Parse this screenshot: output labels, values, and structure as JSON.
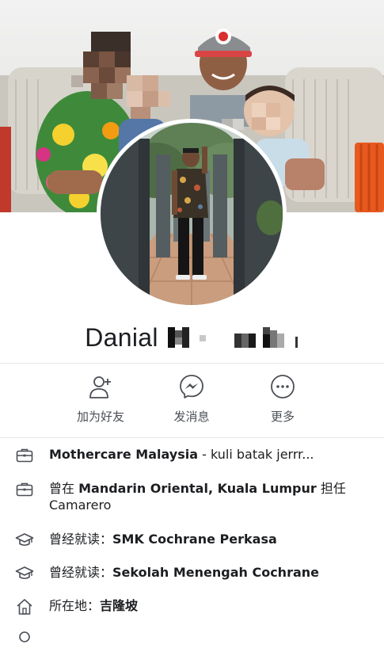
{
  "profile": {
    "first_name": "Danial"
  },
  "actions": [
    {
      "label": "加为好友",
      "icon": "add-friend-icon"
    },
    {
      "label": "发消息",
      "icon": "messenger-icon"
    },
    {
      "label": "更多",
      "icon": "more-icon"
    }
  ],
  "info": {
    "work_current": {
      "icon": "briefcase-icon",
      "employer": "Mothercare Malaysia",
      "suffix": " - kuli batak jerrr..."
    },
    "work_past": {
      "icon": "briefcase-icon",
      "prefix": "曾在 ",
      "employer": "Mandarin Oriental, Kuala Lumpur",
      "middle": " 担任",
      "position": "Camarero"
    },
    "education_1": {
      "icon": "graduation-cap-icon",
      "prefix": "曾经就读：",
      "school": "SMK Cochrane Perkasa"
    },
    "education_2": {
      "icon": "graduation-cap-icon",
      "prefix": "曾经就读：",
      "school": "Sekolah Menengah Cochrane"
    },
    "location": {
      "icon": "home-icon",
      "prefix": "所在地：",
      "city": "吉隆坡"
    }
  },
  "colors": {
    "text": "#1c1e21",
    "secondary_text": "#4b4f56",
    "icon": "#4b4f56",
    "divider": "#e4e6eb"
  }
}
